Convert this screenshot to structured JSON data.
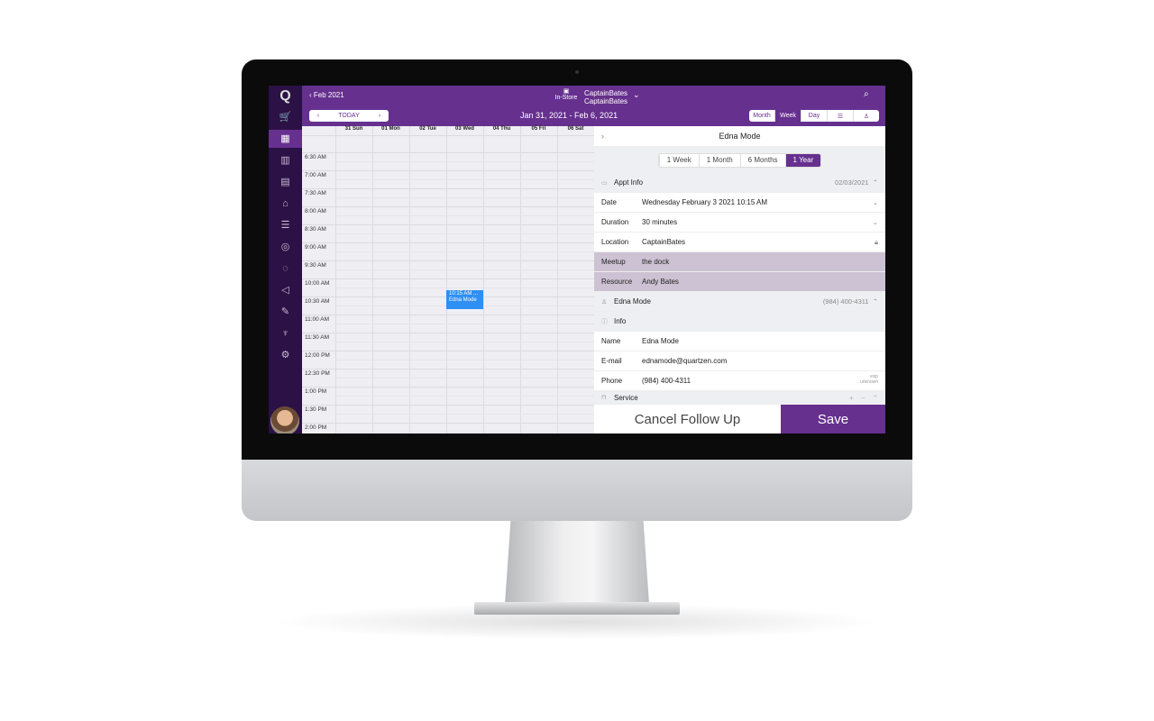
{
  "sidebar": {
    "logo": "Q",
    "items": [
      {
        "icon": "cart-icon",
        "glyph": "🛒"
      },
      {
        "icon": "calendar-icon",
        "glyph": "▦",
        "active": true
      },
      {
        "icon": "building-icon",
        "glyph": "▥"
      },
      {
        "icon": "receipt-search-icon",
        "glyph": "▤"
      },
      {
        "icon": "bank-icon",
        "glyph": "⌂"
      },
      {
        "icon": "list-icon",
        "glyph": "☰"
      },
      {
        "icon": "camera-icon",
        "glyph": "◎"
      },
      {
        "icon": "chat-icon",
        "glyph": "◌"
      },
      {
        "icon": "megaphone-icon",
        "glyph": "◁"
      },
      {
        "icon": "wrench-icon",
        "glyph": "✎"
      },
      {
        "icon": "trophy-icon",
        "glyph": "♆"
      },
      {
        "icon": "gear-icon",
        "glyph": "⚙"
      }
    ]
  },
  "topbar": {
    "back_label": "Feb 2021",
    "store_mode": "In-Store",
    "location_line1": "CaptainBates",
    "location_line2": "CaptainBates",
    "today_label": "TODAY",
    "date_range": "Jan 31, 2021 - Feb 6, 2021",
    "views": [
      "Month",
      "Week",
      "Day",
      "☰",
      "♙"
    ],
    "active_view": "Week"
  },
  "calendar": {
    "days": [
      "31 Sun",
      "01 Mon",
      "02 Tue",
      "03 Wed",
      "04 Thu",
      "05 Fri",
      "06 Sat"
    ],
    "times": [
      "6:30 AM",
      "7:00 AM",
      "7:30 AM",
      "8:00 AM",
      "8:30 AM",
      "9:00 AM",
      "9:30 AM",
      "10:00 AM",
      "10:30 AM",
      "11:00 AM",
      "11:30 AM",
      "12:00 PM",
      "12:30 PM",
      "1:00 PM",
      "1:30 PM",
      "2:00 PM"
    ],
    "event": {
      "time": "10:15 AM ...",
      "name": "Edna Mode",
      "day": "03 Wed",
      "color": "#2e8ff5"
    }
  },
  "panel": {
    "title": "Edna Mode",
    "ranges": [
      "1 Week",
      "1 Month",
      "6 Months",
      "1 Year"
    ],
    "active_range": "1 Year",
    "appt_header": "Appt Info",
    "appt_date": "02/03/2021",
    "appt_rows": [
      {
        "label": "Date",
        "value": "Wednesday February 3 2021 10:15 AM"
      },
      {
        "label": "Duration",
        "value": "30 minutes"
      },
      {
        "label": "Location",
        "value": "CaptainBates"
      },
      {
        "label": "Meetup",
        "value": "the dock"
      },
      {
        "label": "Resource",
        "value": "Andy Bates"
      }
    ],
    "customer_header": "Edna Mode",
    "customer_phone": "(984) 400-4311",
    "info_header": "Info",
    "info_rows": [
      {
        "label": "Name",
        "value": "Edna Mode"
      },
      {
        "label": "E-mail",
        "value": "ednamode@quartzen.com"
      },
      {
        "label": "Phone",
        "value": "(984) 400-4311"
      }
    ],
    "phone_type1": "voip",
    "phone_type2": "unknown",
    "service_header": "Service",
    "cancel_label": "Cancel Follow Up",
    "save_label": "Save"
  },
  "colors": {
    "brand": "#66308f",
    "sidebar": "#2b1145",
    "event": "#2e8ff5",
    "highlight_rows": "#cdc2d3"
  }
}
